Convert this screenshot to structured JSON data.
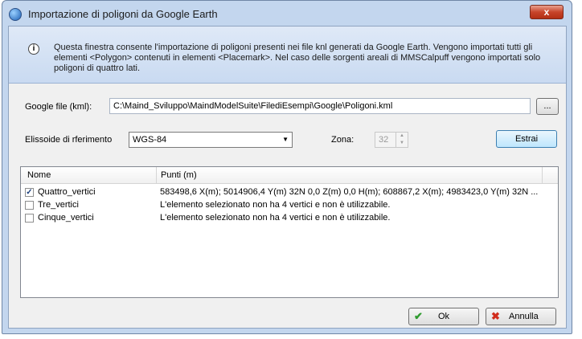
{
  "window": {
    "title": "Importazione di poligoni da Google Earth",
    "close_glyph": "x",
    "icon": "app-globe-icon"
  },
  "banner": {
    "icon": "info-icon",
    "text": "Questa finestra consente l'importazione di poligoni presenti nei file knl generati da Google Earth. Vengono importati tutti gli elementi <Polygon> contenuti in elementi <Placemark>. Nel caso delle sorgenti areali di MMSCalpuff vengono importati solo poligoni di quattro lati."
  },
  "file": {
    "label": "Google file (kml):",
    "value": "C:\\Maind_Sviluppo\\MaindModelSuite\\FilediEsempi\\Google\\Poligoni.kml",
    "browse_label": "..."
  },
  "ellipsoid": {
    "label": "Elissoide di rferimento",
    "value": "WGS-84"
  },
  "zone": {
    "label": "Zona:",
    "value": "32"
  },
  "extract_button": "Estrai",
  "table": {
    "columns": [
      "Nome",
      "Punti (m)"
    ],
    "rows": [
      {
        "checked": true,
        "name": "Quattro_vertici",
        "points": "583498,6 X(m); 5014906,4 Y(m) 32N  0,0 Z(m) 0,0 H(m); 608867,2 X(m); 4983423,0 Y(m) 32N  ..."
      },
      {
        "checked": false,
        "name": "Tre_vertici",
        "points": "L'elemento selezionato non ha 4 vertici e non è utilizzabile."
      },
      {
        "checked": false,
        "name": "Cinque_vertici",
        "points": "L'elemento selezionato non ha 4 vertici e non è utilizzabile."
      }
    ]
  },
  "footer": {
    "ok_label": "Ok",
    "cancel_label": "Annulla"
  }
}
